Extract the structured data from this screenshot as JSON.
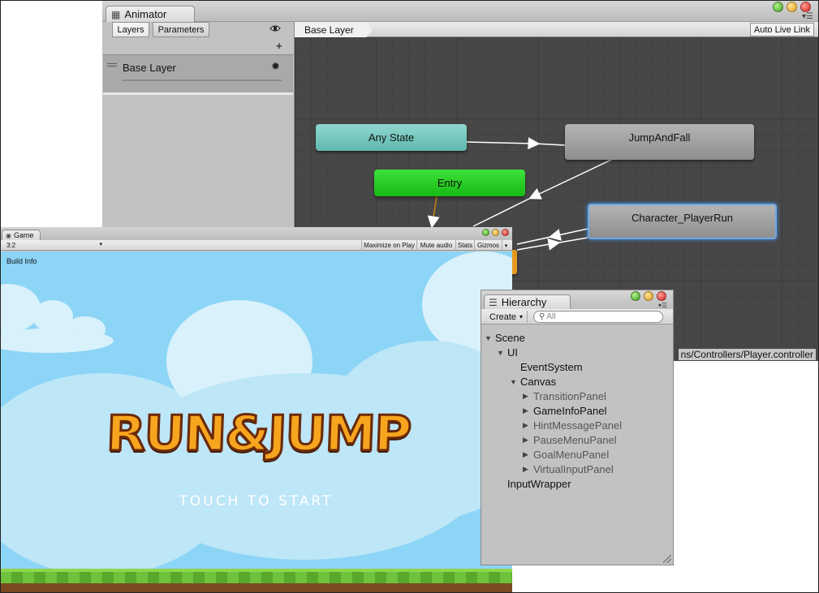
{
  "animator": {
    "tab_title": "Animator",
    "tabs": {
      "layers": "Layers",
      "parameters": "Parameters"
    },
    "add_symbol": "+",
    "layer": {
      "name": "Base Layer"
    },
    "breadcrumb": "Base Layer",
    "auto_live_link": "Auto Live Link",
    "states": {
      "any_state": "Any State",
      "entry": "Entry",
      "jump_and_fall": "JumpAndFall",
      "player_run": "Character_PlayerRun"
    },
    "asset_path": "ns/Controllers/Player.controller"
  },
  "game": {
    "tab_title": "Game",
    "aspect": "3:2",
    "toolbar": {
      "maximize": "Maximize on Play",
      "mute": "Mute audio",
      "stats": "Stats",
      "gizmos": "Gizmos"
    },
    "build_info": "Build Info",
    "logo_text": "RUN&JUMP",
    "touch_text": "TOUCH TO START"
  },
  "hierarchy": {
    "tab_title": "Hierarchy",
    "create": "Create",
    "search_placeholder": "All",
    "tree": {
      "scene": "Scene",
      "ui": "UI",
      "event_system": "EventSystem",
      "canvas": "Canvas",
      "transition_panel": "TransitionPanel",
      "game_info_panel": "GameInfoPanel",
      "hint_message_panel": "HintMessagePanel",
      "pause_menu_panel": "PauseMenuPanel",
      "goal_menu_panel": "GoalMenuPanel",
      "virtual_input_panel": "VirtualInputPanel",
      "input_wrapper": "InputWrapper"
    }
  },
  "colors": {
    "graph_bg": "#474747",
    "any_state": "#6cc6bb",
    "entry": "#26c923",
    "state_gray": "#a3a3a3",
    "selected_outline": "#4a90e2",
    "sky": "#8cd5f6",
    "logo_orange": "#f7a51e"
  }
}
